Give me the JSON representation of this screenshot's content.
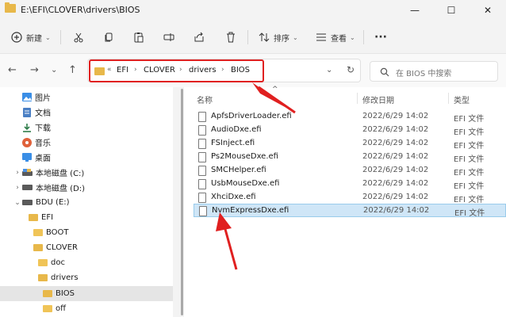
{
  "window": {
    "title": "E:\\EFI\\CLOVER\\drivers\\BIOS",
    "minimize": "—",
    "maximize": "☐",
    "close": "✕"
  },
  "toolbar": {
    "new_label": "新建",
    "sort_label": "排序",
    "view_label": "查看",
    "more": "···",
    "caret": "⌄",
    "icons": [
      "cut-icon",
      "copy-icon",
      "paste-icon",
      "rename-icon",
      "share-icon",
      "delete-icon"
    ]
  },
  "nav": {
    "back": "←",
    "forward": "→",
    "recent": "⌄",
    "up": "↑"
  },
  "address": {
    "crumbs": [
      "EFI",
      "CLOVER",
      "drivers",
      "BIOS"
    ],
    "prefix": "«",
    "separator": "›",
    "dropdown": "⌄",
    "refresh": "↻"
  },
  "search": {
    "placeholder": "在 BIOS 中搜索"
  },
  "sidebar": {
    "items": [
      {
        "label": "图片",
        "icon": "pictures-icon",
        "indent": 0
      },
      {
        "label": "文档",
        "icon": "documents-icon",
        "indent": 0
      },
      {
        "label": "下载",
        "icon": "downloads-icon",
        "indent": 0
      },
      {
        "label": "音乐",
        "icon": "music-icon",
        "indent": 0
      },
      {
        "label": "桌面",
        "icon": "desktop-icon",
        "indent": 0
      },
      {
        "label": "本地磁盘 (C:)",
        "icon": "drive-icon",
        "indent": 0,
        "chevron": "›"
      },
      {
        "label": "本地磁盘 (D:)",
        "icon": "drive-icon",
        "indent": 0,
        "chevron": "›"
      },
      {
        "label": "BDU (E:)",
        "icon": "drive-icon",
        "indent": 0,
        "chevron": "⌄"
      },
      {
        "label": "EFI",
        "icon": "folder-icon",
        "indent": 1
      },
      {
        "label": "BOOT",
        "icon": "folder-icon",
        "indent": 2
      },
      {
        "label": "CLOVER",
        "icon": "folder-icon",
        "indent": 2
      },
      {
        "label": "doc",
        "icon": "folder-icon",
        "indent": 3
      },
      {
        "label": "drivers",
        "icon": "folder-icon",
        "indent": 3
      },
      {
        "label": "BIOS",
        "icon": "folder-icon",
        "indent": 4,
        "selected": true
      },
      {
        "label": "off",
        "icon": "folder-icon",
        "indent": 4
      }
    ]
  },
  "columns": {
    "name": "名称",
    "date": "修改日期",
    "type": "类型",
    "sort_indicator": "^"
  },
  "files": [
    {
      "name": "ApfsDriverLoader.efi",
      "date": "2022/6/29 14:02",
      "type": "EFI 文件"
    },
    {
      "name": "AudioDxe.efi",
      "date": "2022/6/29 14:02",
      "type": "EFI 文件"
    },
    {
      "name": "FSInject.efi",
      "date": "2022/6/29 14:02",
      "type": "EFI 文件"
    },
    {
      "name": "Ps2MouseDxe.efi",
      "date": "2022/6/29 14:02",
      "type": "EFI 文件"
    },
    {
      "name": "SMCHelper.efi",
      "date": "2022/6/29 14:02",
      "type": "EFI 文件"
    },
    {
      "name": "UsbMouseDxe.efi",
      "date": "2022/6/29 14:02",
      "type": "EFI 文件"
    },
    {
      "name": "XhciDxe.efi",
      "date": "2022/6/29 14:02",
      "type": "EFI 文件"
    },
    {
      "name": "NvmExpressDxe.efi",
      "date": "2022/6/29 14:02",
      "type": "EFI 文件",
      "selected": true
    }
  ],
  "annotation_color": "#e02020"
}
